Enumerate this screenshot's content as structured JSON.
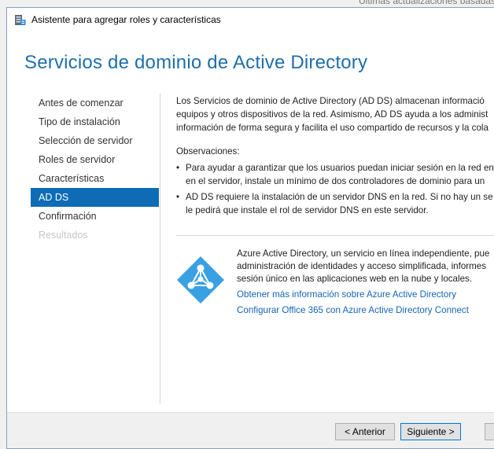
{
  "background_window": {
    "partial_text": "Últimas actualizaciones basadas"
  },
  "window": {
    "title": "Asistente para agregar roles y características",
    "icon": "server-manager-icon"
  },
  "header": {
    "title": "Servicios de dominio de Active Directory"
  },
  "sidebar": {
    "items": [
      {
        "label": "Antes de comenzar",
        "state": "normal"
      },
      {
        "label": "Tipo de instalación",
        "state": "normal"
      },
      {
        "label": "Selección de servidor",
        "state": "normal"
      },
      {
        "label": "Roles de servidor",
        "state": "normal"
      },
      {
        "label": "Características",
        "state": "normal"
      },
      {
        "label": "AD DS",
        "state": "active"
      },
      {
        "label": "Confirmación",
        "state": "normal"
      },
      {
        "label": "Resultados",
        "state": "disabled"
      }
    ]
  },
  "content": {
    "intro_lines": [
      "Los Servicios de dominio de Active Directory (AD DS) almacenan informació",
      "equipos y otros dispositivos de la red. Asimismo, AD DS ayuda a los administ",
      "información de forma segura y facilita el uso compartido de recursos y la cola"
    ],
    "observations_heading": "Observaciones:",
    "bullets": [
      {
        "line1": "Para ayudar a garantizar que los usuarios puedan iniciar sesión en la red en",
        "line2": "en el servidor, instale un mínimo de dos controladores de dominio para un"
      },
      {
        "line1": "AD DS requiere la instalación de un servidor DNS en la red. Si no hay un se",
        "line2": "le pedirá que instale el rol de servidor DNS en este servidor."
      }
    ]
  },
  "azure": {
    "icon": "azure-active-directory-icon",
    "lines": [
      "Azure Active Directory, un servicio en línea independiente, pue",
      "administración de identidades y acceso simplificada, informes",
      "sesión único en las aplicaciones web en la nube y locales."
    ],
    "link1": "Obtener más información sobre Azure Active Directory",
    "link2": "Configurar Office 365 con Azure Active Directory Connect",
    "color": "#3aa0e4"
  },
  "footer": {
    "back_label": "< Anterior",
    "next_label": "Siguiente >"
  },
  "colors": {
    "accent": "#0e6cb6",
    "title": "#1e6fab",
    "link": "#1565b3"
  }
}
